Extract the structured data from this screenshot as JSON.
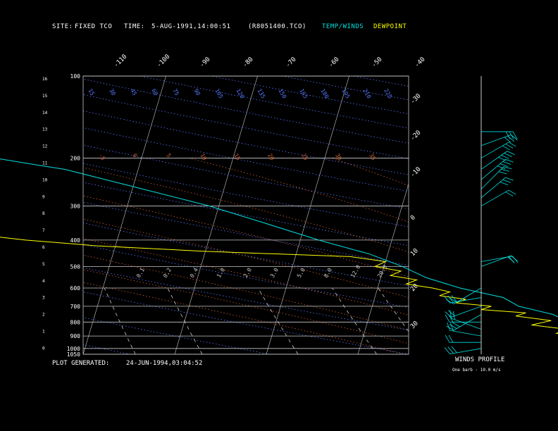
{
  "header": {
    "site_label": "SITE:",
    "site_value": "FIXED  TCO",
    "time_label": "TIME:",
    "time_value": "5-AUG-1991,14:00:51",
    "file": "(R8051400.TCO)",
    "legend_temp": "TEMP/WINDS",
    "legend_dew": "DEWPOINT"
  },
  "footer": {
    "generated_label": "PLOT GENERATED:",
    "generated_value": "24-JUN-1994,03:04:52",
    "winds_title": "WINDS PROFILE",
    "barb_note": "One barb - 10.0 m/s"
  },
  "colors": {
    "temp": "#00e0e0",
    "dewpoint": "#ffff00",
    "isotherm": "#c8c8c8",
    "dry_adiabat": "#5878ff",
    "moist_adiabat": "#d06030",
    "mixing_ratio": "#c8c8c8",
    "background": "#000000"
  },
  "chart_data": {
    "type": "line",
    "title": "",
    "pressure_levels": [
      100,
      200,
      300,
      400,
      500,
      600,
      700,
      800,
      900,
      1000,
      1050
    ],
    "height_km_ticks": [
      "16",
      "15",
      "14",
      "13",
      "12",
      "11",
      "10",
      "9",
      "8",
      "7",
      "6",
      "5",
      "4",
      "3",
      "2",
      "1",
      "0"
    ],
    "isotherm_labels": [
      "-110",
      "-100",
      "-90",
      "-80",
      "-70",
      "-60",
      "-50",
      "-40",
      "-30",
      "-20",
      "-10",
      "0",
      "10",
      "20",
      "30"
    ],
    "dry_adiabat_labels": [
      "15",
      "30",
      "45",
      "60",
      "75",
      "90",
      "105",
      "120",
      "135",
      "150",
      "165",
      "180",
      "195",
      "210",
      "225"
    ],
    "moist_adiabat_labels": [
      "-5",
      "0",
      "5",
      "10",
      "15",
      "20",
      "25",
      "30",
      "35"
    ],
    "mixing_ratio_labels": [
      "0.1",
      "0.2",
      "0.4",
      "1.0",
      "2.0",
      "3.0",
      "5.0",
      "8.0",
      "12.0",
      "20.0"
    ],
    "series": [
      {
        "name": "TEMP/WINDS",
        "points": [
          [
            1050,
            27.5
          ],
          [
            1000,
            25
          ],
          [
            950,
            22
          ],
          [
            900,
            18
          ],
          [
            850,
            15
          ],
          [
            800,
            12
          ],
          [
            750,
            10
          ],
          [
            700,
            6
          ],
          [
            650,
            4
          ],
          [
            600,
            -1
          ],
          [
            550,
            -5
          ],
          [
            500,
            -8
          ],
          [
            450,
            -12
          ],
          [
            400,
            -18
          ],
          [
            350,
            -24
          ],
          [
            300,
            -31
          ],
          [
            250,
            -41
          ],
          [
            220,
            -48
          ],
          [
            210,
            -52
          ],
          [
            200,
            -56
          ],
          [
            180,
            -60
          ],
          [
            160,
            -63
          ],
          [
            140,
            -66
          ],
          [
            120,
            -69
          ],
          [
            110,
            -70
          ],
          [
            100,
            -71
          ]
        ]
      },
      {
        "name": "DEWPOINT",
        "points": [
          [
            1050,
            22
          ],
          [
            1000,
            20
          ],
          [
            960,
            16
          ],
          [
            920,
            15
          ],
          [
            880,
            11
          ],
          [
            850,
            12
          ],
          [
            820,
            8
          ],
          [
            790,
            10
          ],
          [
            760,
            6
          ],
          [
            740,
            7
          ],
          [
            720,
            2
          ],
          [
            700,
            3
          ],
          [
            680,
            -1
          ],
          [
            660,
            0
          ],
          [
            640,
            -3
          ],
          [
            620,
            -2
          ],
          [
            600,
            -4
          ],
          [
            580,
            -7
          ],
          [
            560,
            -6
          ],
          [
            540,
            -9
          ],
          [
            520,
            -8
          ],
          [
            500,
            -11
          ],
          [
            480,
            -10
          ],
          [
            460,
            -14
          ],
          [
            440,
            -30
          ],
          [
            420,
            -42
          ],
          [
            400,
            -50
          ],
          [
            380,
            -56
          ],
          [
            360,
            -61
          ],
          [
            340,
            -68
          ],
          [
            330,
            -71
          ],
          [
            320,
            -69
          ],
          [
            310,
            -73
          ],
          [
            300,
            -70
          ],
          [
            280,
            -75
          ],
          [
            260,
            -79
          ],
          [
            250,
            -82
          ],
          [
            240,
            -84
          ],
          [
            230,
            -86
          ],
          [
            220,
            -87
          ],
          [
            210,
            -86
          ],
          [
            205,
            -88
          ]
        ]
      }
    ],
    "winds": [
      {
        "p": 160,
        "dir": 270,
        "spd": 25
      },
      {
        "p": 180,
        "dir": 250,
        "spd": 30
      },
      {
        "p": 200,
        "dir": 240,
        "spd": 30
      },
      {
        "p": 220,
        "dir": 235,
        "spd": 35
      },
      {
        "p": 240,
        "dir": 230,
        "spd": 35
      },
      {
        "p": 260,
        "dir": 225,
        "spd": 30
      },
      {
        "p": 280,
        "dir": 230,
        "spd": 25
      },
      {
        "p": 300,
        "dir": 240,
        "spd": 20
      },
      {
        "p": 480,
        "dir": 260,
        "spd": 20
      },
      {
        "p": 500,
        "dir": 250,
        "spd": 15
      },
      {
        "p": 600,
        "dir": 60,
        "spd": 20
      },
      {
        "p": 650,
        "dir": 80,
        "spd": 25
      },
      {
        "p": 700,
        "dir": 70,
        "spd": 20
      },
      {
        "p": 750,
        "dir": 60,
        "spd": 25
      },
      {
        "p": 800,
        "dir": 90,
        "spd": 20
      },
      {
        "p": 850,
        "dir": 110,
        "spd": 15
      },
      {
        "p": 900,
        "dir": 100,
        "spd": 15
      },
      {
        "p": 950,
        "dir": 90,
        "spd": 20
      },
      {
        "p": 1000,
        "dir": 80,
        "spd": 25
      }
    ]
  }
}
